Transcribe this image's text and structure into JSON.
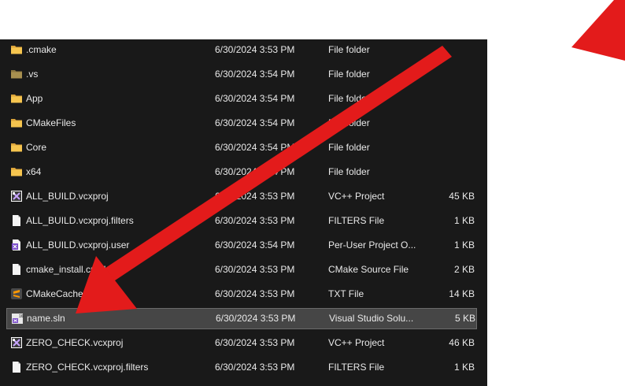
{
  "files": [
    {
      "name": ".cmake",
      "date": "6/30/2024 3:53 PM",
      "type": "File folder",
      "size": "",
      "icon": "folder-icon"
    },
    {
      "name": ".vs",
      "date": "6/30/2024 3:54 PM",
      "type": "File folder",
      "size": "",
      "icon": "folder-hidden-icon"
    },
    {
      "name": "App",
      "date": "6/30/2024 3:54 PM",
      "type": "File folder",
      "size": "",
      "icon": "folder-icon"
    },
    {
      "name": "CMakeFiles",
      "date": "6/30/2024 3:54 PM",
      "type": "File folder",
      "size": "",
      "icon": "folder-icon"
    },
    {
      "name": "Core",
      "date": "6/30/2024 3:54 PM",
      "type": "File folder",
      "size": "",
      "icon": "folder-icon"
    },
    {
      "name": "x64",
      "date": "6/30/2024 3:54 PM",
      "type": "File folder",
      "size": "",
      "icon": "folder-icon"
    },
    {
      "name": "ALL_BUILD.vcxproj",
      "date": "6/30/2024 3:53 PM",
      "type": "VC++ Project",
      "size": "45 KB",
      "icon": "vcxproj-icon"
    },
    {
      "name": "ALL_BUILD.vcxproj.filters",
      "date": "6/30/2024 3:53 PM",
      "type": "FILTERS File",
      "size": "1 KB",
      "icon": "document-icon"
    },
    {
      "name": "ALL_BUILD.vcxproj.user",
      "date": "6/30/2024 3:54 PM",
      "type": "Per-User Project O...",
      "size": "1 KB",
      "icon": "vs-user-icon"
    },
    {
      "name": "cmake_install.cmake",
      "date": "6/30/2024 3:53 PM",
      "type": "CMake Source File",
      "size": "2 KB",
      "icon": "document-icon"
    },
    {
      "name": "CMakeCache.txt",
      "date": "6/30/2024 3:53 PM",
      "type": "TXT File",
      "size": "14 KB",
      "icon": "sublime-icon"
    },
    {
      "name": "name.sln",
      "date": "6/30/2024 3:53 PM",
      "type": "Visual Studio Solu...",
      "size": "5 KB",
      "icon": "vs-solution-icon",
      "selected": true
    },
    {
      "name": "ZERO_CHECK.vcxproj",
      "date": "6/30/2024 3:53 PM",
      "type": "VC++ Project",
      "size": "46 KB",
      "icon": "vcxproj-icon"
    },
    {
      "name": "ZERO_CHECK.vcxproj.filters",
      "date": "6/30/2024 3:53 PM",
      "type": "FILTERS File",
      "size": "1 KB",
      "icon": "document-icon"
    }
  ],
  "colors": {
    "background": "#191919",
    "selection": "#464646",
    "text": "#e9e9e9",
    "folder": "#f2c14e",
    "annotation_arrow": "#e31b1b"
  }
}
